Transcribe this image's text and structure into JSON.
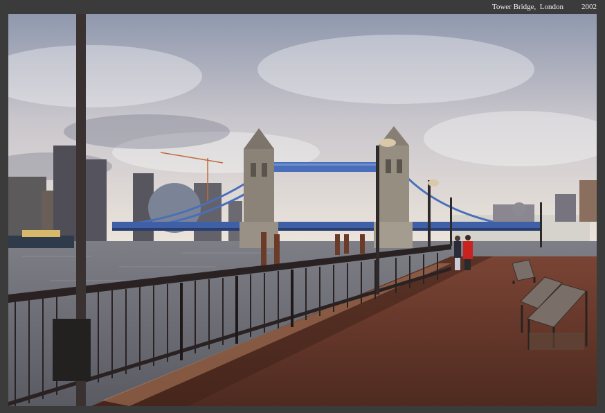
{
  "caption": {
    "place": "Tower Bridge,  London",
    "year": "2002"
  },
  "colors": {
    "frame": "#3b3b3b",
    "sky_top": "#9aa2b6",
    "sky_bottom": "#e8e2dc",
    "river": "#6d6f78",
    "walkway": "#6b3a2c",
    "railing": "#2a2222",
    "bridge_blue": "#4a6fb8",
    "tower_stone": "#8c8378"
  }
}
